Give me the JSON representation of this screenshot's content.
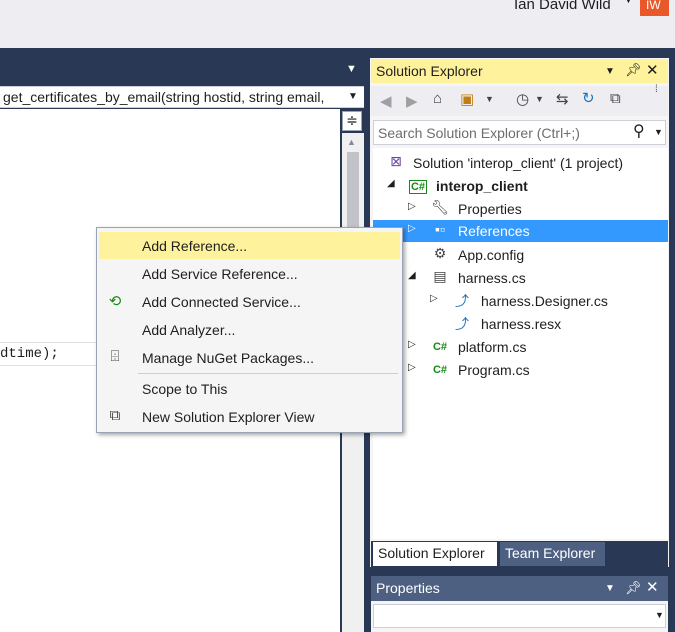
{
  "user": {
    "name": "Ian David Wild",
    "initials": "IW"
  },
  "editor": {
    "nav_combo_text": "get_certificates_by_email(string hostid, string email,",
    "code_line": "dtime);",
    "split_glyph": "≑"
  },
  "context_menu": {
    "items": [
      {
        "label": "Add Reference...",
        "icon": ""
      },
      {
        "label": "Add Service Reference...",
        "icon": ""
      },
      {
        "label": "Add Connected Service...",
        "icon": "connected-service-icon"
      },
      {
        "label": "Add Analyzer...",
        "icon": ""
      },
      {
        "label": "Manage NuGet Packages...",
        "icon": "nuget-icon"
      },
      {
        "label": "Scope to This",
        "icon": ""
      },
      {
        "label": "New Solution Explorer View",
        "icon": "new-view-icon"
      }
    ],
    "highlighted_index": 0
  },
  "solution_explorer": {
    "title": "Solution Explorer",
    "search_placeholder": "Search Solution Explorer (Ctrl+;)",
    "tree": [
      {
        "label": "Solution 'interop_client' (1 project)",
        "icon": "solution-icon"
      },
      {
        "label": "interop_client",
        "icon": "csharp-project-icon"
      },
      {
        "label": "Properties",
        "icon": "wrench-icon"
      },
      {
        "label": "References",
        "icon": "references-icon"
      },
      {
        "label": "App.config",
        "icon": "config-file-icon"
      },
      {
        "label": "harness.cs",
        "icon": "form-icon"
      },
      {
        "label": "harness.Designer.cs",
        "icon": "designer-file-icon"
      },
      {
        "label": "harness.resx",
        "icon": "resx-file-icon"
      },
      {
        "label": "platform.cs",
        "icon": "csharp-file-icon"
      },
      {
        "label": "Program.cs",
        "icon": "csharp-file-icon"
      }
    ],
    "selected_label": "References",
    "tabs": [
      "Solution Explorer",
      "Team Explorer"
    ],
    "active_tab": "Solution Explorer"
  },
  "properties": {
    "title": "Properties"
  },
  "colors": {
    "chrome": "#293955",
    "highlight": "#fff29d",
    "selection": "#3399ff",
    "csharp": "#178a17",
    "avatar": "#e8582a"
  }
}
